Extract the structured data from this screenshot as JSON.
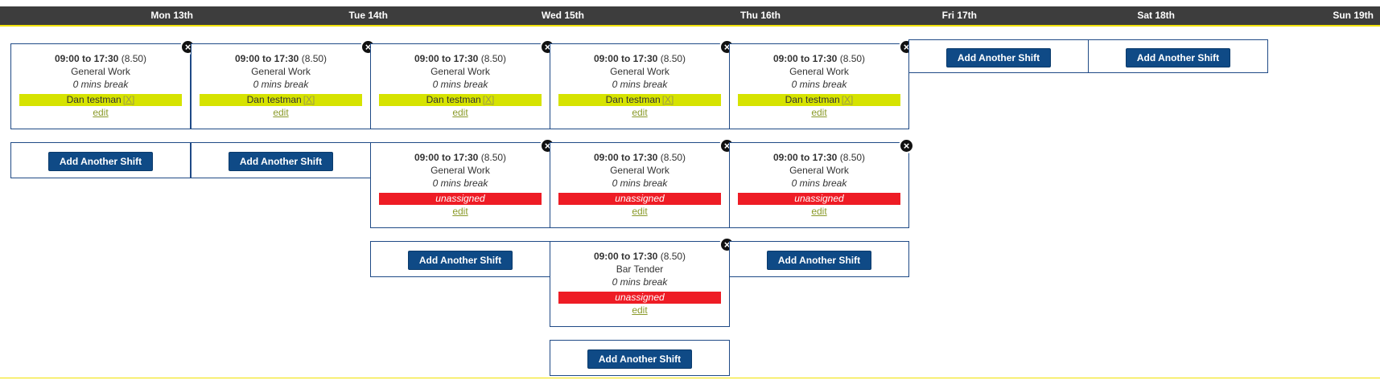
{
  "days": [
    {
      "label": "Mon 13th"
    },
    {
      "label": "Tue 14th"
    },
    {
      "label": "Wed 15th"
    },
    {
      "label": "Thu 16th"
    },
    {
      "label": "Fri 17th"
    },
    {
      "label": "Sat 18th"
    },
    {
      "label": "Sun 19th"
    }
  ],
  "labels": {
    "to": "to",
    "add_shift": "Add Another Shift",
    "edit": "edit",
    "remove": "[X]",
    "unassigned": "unassigned"
  },
  "columns": [
    {
      "shifts": [
        {
          "start": "09:00",
          "end": "17:30",
          "hours": "(8.50)",
          "role": "General Work",
          "break": "0 mins break",
          "assignee": "Dan testman",
          "status": "assigned"
        }
      ]
    },
    {
      "shifts": [
        {
          "start": "09:00",
          "end": "17:30",
          "hours": "(8.50)",
          "role": "General Work",
          "break": "0 mins break",
          "assignee": "Dan testman",
          "status": "assigned"
        }
      ]
    },
    {
      "shifts": [
        {
          "start": "09:00",
          "end": "17:30",
          "hours": "(8.50)",
          "role": "General Work",
          "break": "0 mins break",
          "assignee": "Dan testman",
          "status": "assigned"
        },
        {
          "start": "09:00",
          "end": "17:30",
          "hours": "(8.50)",
          "role": "General Work",
          "break": "0 mins break",
          "assignee": "",
          "status": "unassigned"
        }
      ]
    },
    {
      "shifts": [
        {
          "start": "09:00",
          "end": "17:30",
          "hours": "(8.50)",
          "role": "General Work",
          "break": "0 mins break",
          "assignee": "Dan testman",
          "status": "assigned"
        },
        {
          "start": "09:00",
          "end": "17:30",
          "hours": "(8.50)",
          "role": "General Work",
          "break": "0 mins break",
          "assignee": "",
          "status": "unassigned"
        },
        {
          "start": "09:00",
          "end": "17:30",
          "hours": "(8.50)",
          "role": "Bar Tender",
          "break": "0 mins break",
          "assignee": "",
          "status": "unassigned"
        }
      ]
    },
    {
      "shifts": [
        {
          "start": "09:00",
          "end": "17:30",
          "hours": "(8.50)",
          "role": "General Work",
          "break": "0 mins break",
          "assignee": "Dan testman",
          "status": "assigned"
        },
        {
          "start": "09:00",
          "end": "17:30",
          "hours": "(8.50)",
          "role": "General Work",
          "break": "0 mins break",
          "assignee": "",
          "status": "unassigned"
        }
      ]
    },
    {
      "shifts": []
    },
    {
      "shifts": []
    }
  ],
  "colors": {
    "header_bg": "#3d3d3d",
    "accent_yellow": "#f2e200",
    "assigned_bg": "#d6e300",
    "unassigned_bg": "#ee1c25",
    "button_bg": "#0f4a86",
    "card_border": "#1f4a86"
  }
}
